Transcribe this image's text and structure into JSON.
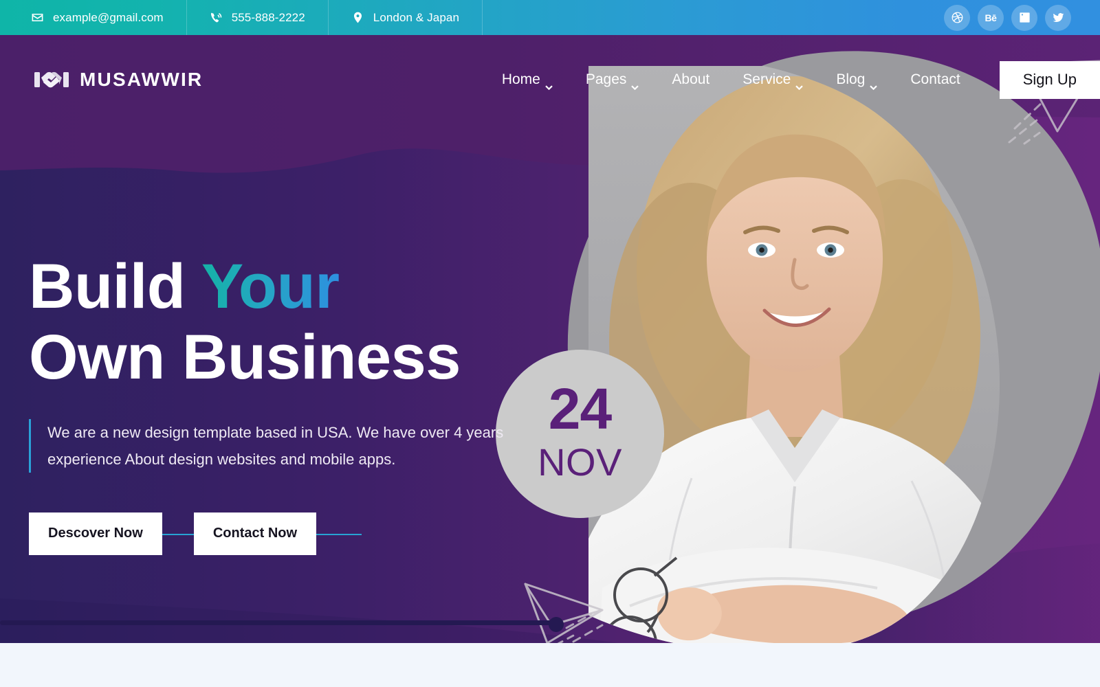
{
  "topbar": {
    "contacts": [
      {
        "icon": "envelope-icon",
        "text": "example@gmail.com"
      },
      {
        "icon": "phone-volume-icon",
        "text": "555-888-2222"
      },
      {
        "icon": "map-pin-icon",
        "text": "London & Japan"
      }
    ],
    "socials": [
      {
        "name": "dribbble-icon",
        "label": "Dribbble"
      },
      {
        "name": "behance-icon",
        "label": "Bē"
      },
      {
        "name": "linkedin-icon",
        "label": "LinkedIn"
      },
      {
        "name": "twitter-icon",
        "label": "Twitter"
      }
    ],
    "gradient_start": "#0fb5a8",
    "gradient_end": "#3190e0"
  },
  "header": {
    "logo_text": "MUSAWWIR",
    "logo_icon": "handshake-icon",
    "nav": [
      {
        "label": "Home",
        "has_dropdown": true
      },
      {
        "label": "Pages",
        "has_dropdown": true
      },
      {
        "label": "About",
        "has_dropdown": false
      },
      {
        "label": "Service",
        "has_dropdown": true
      },
      {
        "label": "Blog",
        "has_dropdown": true
      },
      {
        "label": "Contact",
        "has_dropdown": false
      }
    ],
    "signup_label": "Sign Up",
    "bg_color": "#4e2069"
  },
  "hero": {
    "headline_line1_a": "Build ",
    "headline_line1_b": "Your",
    "headline_line2": "Own Business",
    "paragraph": "We are a new design template based in USA. We have over 4 years experience About design websites and mobile apps.",
    "buttons": [
      {
        "label": "Descover Now"
      },
      {
        "label": "Contact Now"
      }
    ],
    "accent_color": "#27a3d4",
    "bg_color_left": "#2e2160",
    "bg_color_right": "#66257e"
  },
  "date_badge": {
    "day": "24",
    "month": "NOV",
    "text_color": "#5a2079",
    "bg_color": "#cbcbcb"
  },
  "decor": {
    "plane_top": "paper-plane-icon",
    "plane_lower": "paper-plane-icon"
  },
  "slider": {
    "progress_percent": 51,
    "track_color": "#241952"
  }
}
